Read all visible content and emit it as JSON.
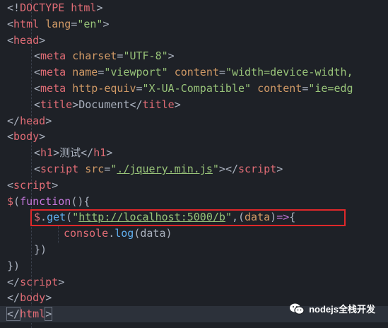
{
  "code": {
    "l1": {
      "open": "<!",
      "tag": "DOCTYPE html",
      "close": ">"
    },
    "l2": {
      "open": "<",
      "tag": "html",
      "attr": "lang",
      "eq": "=",
      "val": "\"en\"",
      "close": ">"
    },
    "l3": {
      "open": "<",
      "tag": "head",
      "close": ">"
    },
    "l4": {
      "open": "<",
      "tag": "meta",
      "attr": "charset",
      "eq": "=",
      "val": "\"UTF-8\"",
      "close": ">"
    },
    "l5": {
      "open": "<",
      "tag": "meta",
      "attr1": "name",
      "eq": "=",
      "val1": "\"viewport\"",
      "attr2": "content",
      "val2": "\"width=device-width,"
    },
    "l6": {
      "open": "<",
      "tag": "meta",
      "attr1": "http-equiv",
      "eq": "=",
      "val1": "\"X-UA-Compatible\"",
      "attr2": "content",
      "val2": "\"ie=edg"
    },
    "l7": {
      "open": "<",
      "tag": "title",
      "close": ">",
      "text": "Document",
      "open2": "</",
      "tag2": "title"
    },
    "l8": {
      "open": "</",
      "tag": "head",
      "close": ">"
    },
    "l9": {
      "open": "<",
      "tag": "body",
      "close": ">"
    },
    "l10": {
      "open": "<",
      "tag": "h1",
      "close": ">",
      "text": "测试",
      "open2": "</",
      "tag2": "h1"
    },
    "l11": {
      "open": "<",
      "tag": "script",
      "attr": "src",
      "eq": "=",
      "q1": "\"",
      "val": "./jquery.min.js",
      "q2": "\"",
      "close": ">",
      "open2": "</",
      "tag2": "script"
    },
    "l12": {
      "open": "<",
      "tag": "script",
      "close": ">"
    },
    "l13": {
      "dollar": "$",
      "p1": "(",
      "kw": "function",
      "p2": "(){"
    },
    "l14": {
      "dollar": "$",
      "dot": ".",
      "fn": "get",
      "p1": "(",
      "q1": "\"",
      "url": "http://localhost:5000/b",
      "q2": "\"",
      "p2": ",(",
      "param": "data",
      "p3": ")",
      "arrow": "=>",
      "p4": "{"
    },
    "l15": {
      "obj": "console",
      "dot": ".",
      "fn": "log",
      "p1": "(",
      "arg": "data",
      "p2": ")"
    },
    "l16": {
      "text": "})"
    },
    "l17": {
      "text": "})"
    },
    "l18": {
      "open": "</",
      "tag": "script",
      "close": ">"
    },
    "l19": {
      "open": "</",
      "tag": "body",
      "close": ">"
    },
    "l20": {
      "open": "</",
      "tag": "html",
      "close": ">"
    }
  },
  "watermark": {
    "text": "nodejs全栈开发",
    "icon": "wechat-icon"
  },
  "colors": {
    "background": "#1e2127",
    "highlight_box": "#e0282a",
    "tag": "#e06c75",
    "attr": "#d19a66",
    "string": "#98c379"
  }
}
